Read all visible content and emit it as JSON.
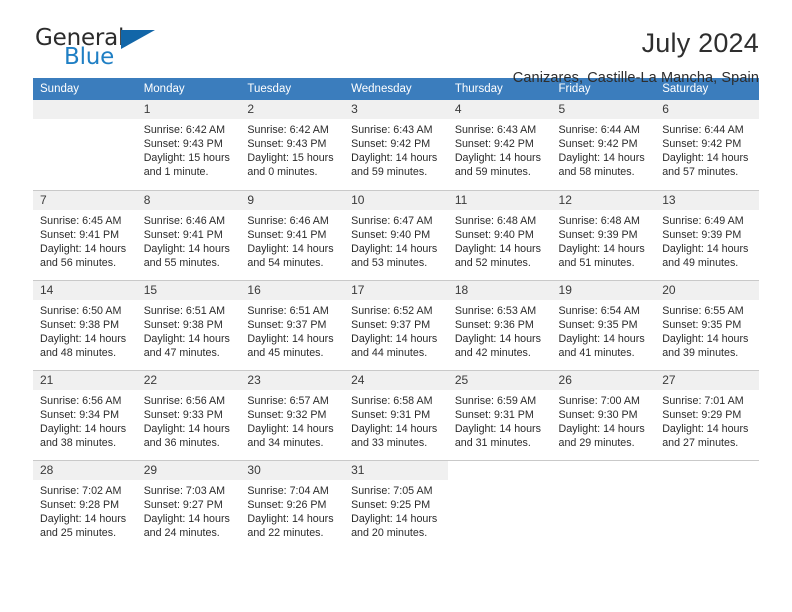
{
  "brand": {
    "name_part1": "General",
    "name_part2": "Blue",
    "flag_icon": "triangle-flag-icon"
  },
  "header": {
    "title": "July 2024",
    "subtitle": "Canizares, Castille-La Mancha, Spain"
  },
  "calendar": {
    "weekday_headers": [
      "Sunday",
      "Monday",
      "Tuesday",
      "Wednesday",
      "Thursday",
      "Friday",
      "Saturday"
    ],
    "accent_color": "#3b7dbd",
    "daynum_band_color": "#f0f0f0",
    "weeks": [
      [
        {
          "day": "",
          "empty": true,
          "sunrise": "",
          "sunset": "",
          "daylight_line1": "",
          "daylight_line2": ""
        },
        {
          "day": "1",
          "sunrise": "Sunrise: 6:42 AM",
          "sunset": "Sunset: 9:43 PM",
          "daylight_line1": "Daylight: 15 hours",
          "daylight_line2": "and 1 minute."
        },
        {
          "day": "2",
          "sunrise": "Sunrise: 6:42 AM",
          "sunset": "Sunset: 9:43 PM",
          "daylight_line1": "Daylight: 15 hours",
          "daylight_line2": "and 0 minutes."
        },
        {
          "day": "3",
          "sunrise": "Sunrise: 6:43 AM",
          "sunset": "Sunset: 9:42 PM",
          "daylight_line1": "Daylight: 14 hours",
          "daylight_line2": "and 59 minutes."
        },
        {
          "day": "4",
          "sunrise": "Sunrise: 6:43 AM",
          "sunset": "Sunset: 9:42 PM",
          "daylight_line1": "Daylight: 14 hours",
          "daylight_line2": "and 59 minutes."
        },
        {
          "day": "5",
          "sunrise": "Sunrise: 6:44 AM",
          "sunset": "Sunset: 9:42 PM",
          "daylight_line1": "Daylight: 14 hours",
          "daylight_line2": "and 58 minutes."
        },
        {
          "day": "6",
          "sunrise": "Sunrise: 6:44 AM",
          "sunset": "Sunset: 9:42 PM",
          "daylight_line1": "Daylight: 14 hours",
          "daylight_line2": "and 57 minutes."
        }
      ],
      [
        {
          "day": "7",
          "sunrise": "Sunrise: 6:45 AM",
          "sunset": "Sunset: 9:41 PM",
          "daylight_line1": "Daylight: 14 hours",
          "daylight_line2": "and 56 minutes."
        },
        {
          "day": "8",
          "sunrise": "Sunrise: 6:46 AM",
          "sunset": "Sunset: 9:41 PM",
          "daylight_line1": "Daylight: 14 hours",
          "daylight_line2": "and 55 minutes."
        },
        {
          "day": "9",
          "sunrise": "Sunrise: 6:46 AM",
          "sunset": "Sunset: 9:41 PM",
          "daylight_line1": "Daylight: 14 hours",
          "daylight_line2": "and 54 minutes."
        },
        {
          "day": "10",
          "sunrise": "Sunrise: 6:47 AM",
          "sunset": "Sunset: 9:40 PM",
          "daylight_line1": "Daylight: 14 hours",
          "daylight_line2": "and 53 minutes."
        },
        {
          "day": "11",
          "sunrise": "Sunrise: 6:48 AM",
          "sunset": "Sunset: 9:40 PM",
          "daylight_line1": "Daylight: 14 hours",
          "daylight_line2": "and 52 minutes."
        },
        {
          "day": "12",
          "sunrise": "Sunrise: 6:48 AM",
          "sunset": "Sunset: 9:39 PM",
          "daylight_line1": "Daylight: 14 hours",
          "daylight_line2": "and 51 minutes."
        },
        {
          "day": "13",
          "sunrise": "Sunrise: 6:49 AM",
          "sunset": "Sunset: 9:39 PM",
          "daylight_line1": "Daylight: 14 hours",
          "daylight_line2": "and 49 minutes."
        }
      ],
      [
        {
          "day": "14",
          "sunrise": "Sunrise: 6:50 AM",
          "sunset": "Sunset: 9:38 PM",
          "daylight_line1": "Daylight: 14 hours",
          "daylight_line2": "and 48 minutes."
        },
        {
          "day": "15",
          "sunrise": "Sunrise: 6:51 AM",
          "sunset": "Sunset: 9:38 PM",
          "daylight_line1": "Daylight: 14 hours",
          "daylight_line2": "and 47 minutes."
        },
        {
          "day": "16",
          "sunrise": "Sunrise: 6:51 AM",
          "sunset": "Sunset: 9:37 PM",
          "daylight_line1": "Daylight: 14 hours",
          "daylight_line2": "and 45 minutes."
        },
        {
          "day": "17",
          "sunrise": "Sunrise: 6:52 AM",
          "sunset": "Sunset: 9:37 PM",
          "daylight_line1": "Daylight: 14 hours",
          "daylight_line2": "and 44 minutes."
        },
        {
          "day": "18",
          "sunrise": "Sunrise: 6:53 AM",
          "sunset": "Sunset: 9:36 PM",
          "daylight_line1": "Daylight: 14 hours",
          "daylight_line2": "and 42 minutes."
        },
        {
          "day": "19",
          "sunrise": "Sunrise: 6:54 AM",
          "sunset": "Sunset: 9:35 PM",
          "daylight_line1": "Daylight: 14 hours",
          "daylight_line2": "and 41 minutes."
        },
        {
          "day": "20",
          "sunrise": "Sunrise: 6:55 AM",
          "sunset": "Sunset: 9:35 PM",
          "daylight_line1": "Daylight: 14 hours",
          "daylight_line2": "and 39 minutes."
        }
      ],
      [
        {
          "day": "21",
          "sunrise": "Sunrise: 6:56 AM",
          "sunset": "Sunset: 9:34 PM",
          "daylight_line1": "Daylight: 14 hours",
          "daylight_line2": "and 38 minutes."
        },
        {
          "day": "22",
          "sunrise": "Sunrise: 6:56 AM",
          "sunset": "Sunset: 9:33 PM",
          "daylight_line1": "Daylight: 14 hours",
          "daylight_line2": "and 36 minutes."
        },
        {
          "day": "23",
          "sunrise": "Sunrise: 6:57 AM",
          "sunset": "Sunset: 9:32 PM",
          "daylight_line1": "Daylight: 14 hours",
          "daylight_line2": "and 34 minutes."
        },
        {
          "day": "24",
          "sunrise": "Sunrise: 6:58 AM",
          "sunset": "Sunset: 9:31 PM",
          "daylight_line1": "Daylight: 14 hours",
          "daylight_line2": "and 33 minutes."
        },
        {
          "day": "25",
          "sunrise": "Sunrise: 6:59 AM",
          "sunset": "Sunset: 9:31 PM",
          "daylight_line1": "Daylight: 14 hours",
          "daylight_line2": "and 31 minutes."
        },
        {
          "day": "26",
          "sunrise": "Sunrise: 7:00 AM",
          "sunset": "Sunset: 9:30 PM",
          "daylight_line1": "Daylight: 14 hours",
          "daylight_line2": "and 29 minutes."
        },
        {
          "day": "27",
          "sunrise": "Sunrise: 7:01 AM",
          "sunset": "Sunset: 9:29 PM",
          "daylight_line1": "Daylight: 14 hours",
          "daylight_line2": "and 27 minutes."
        }
      ],
      [
        {
          "day": "28",
          "sunrise": "Sunrise: 7:02 AM",
          "sunset": "Sunset: 9:28 PM",
          "daylight_line1": "Daylight: 14 hours",
          "daylight_line2": "and 25 minutes."
        },
        {
          "day": "29",
          "sunrise": "Sunrise: 7:03 AM",
          "sunset": "Sunset: 9:27 PM",
          "daylight_line1": "Daylight: 14 hours",
          "daylight_line2": "and 24 minutes."
        },
        {
          "day": "30",
          "sunrise": "Sunrise: 7:04 AM",
          "sunset": "Sunset: 9:26 PM",
          "daylight_line1": "Daylight: 14 hours",
          "daylight_line2": "and 22 minutes."
        },
        {
          "day": "31",
          "sunrise": "Sunrise: 7:05 AM",
          "sunset": "Sunset: 9:25 PM",
          "daylight_line1": "Daylight: 14 hours",
          "daylight_line2": "and 20 minutes."
        },
        {
          "day": "",
          "blank": true,
          "sunrise": "",
          "sunset": "",
          "daylight_line1": "",
          "daylight_line2": ""
        },
        {
          "day": "",
          "blank": true,
          "sunrise": "",
          "sunset": "",
          "daylight_line1": "",
          "daylight_line2": ""
        },
        {
          "day": "",
          "blank": true,
          "sunrise": "",
          "sunset": "",
          "daylight_line1": "",
          "daylight_line2": ""
        }
      ]
    ]
  }
}
